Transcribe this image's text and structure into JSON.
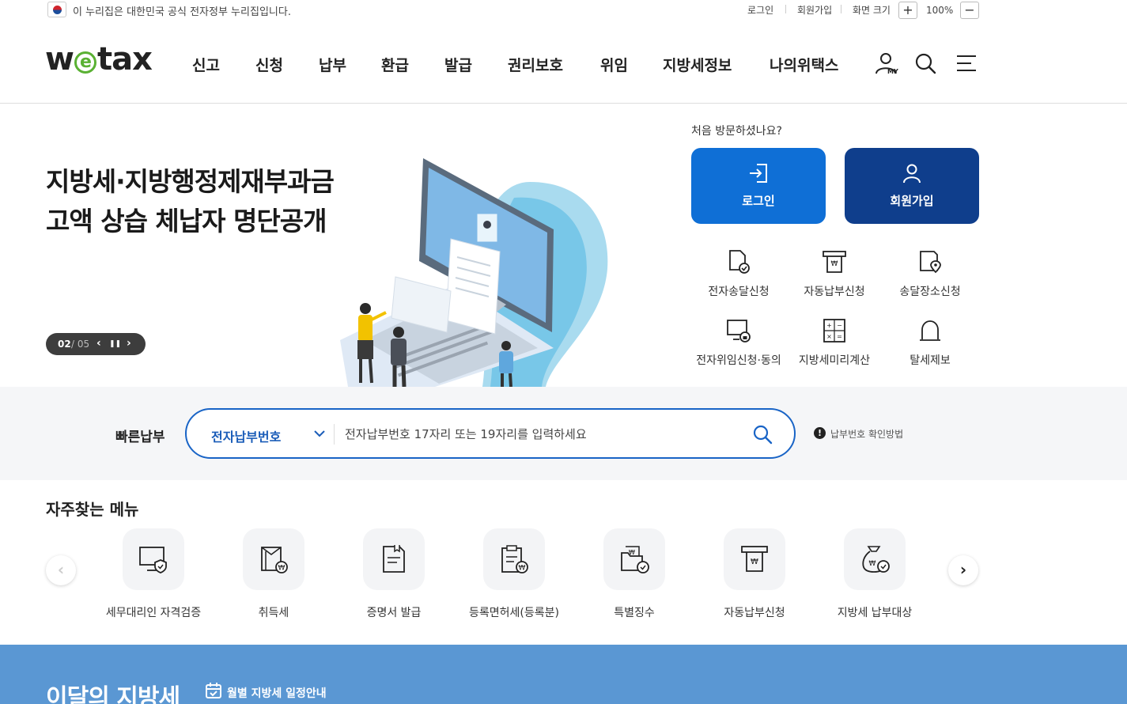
{
  "gov_banner": {
    "text": "이 누리집은 대한민국 공식 전자정부 누리집입니다.",
    "login": "로그인",
    "signup": "회원가입",
    "font_size_label": "화면 크기",
    "zoom_plus": "+",
    "zoom_value": "100%",
    "zoom_minus": "−"
  },
  "header": {
    "logo_w": "w",
    "logo_e": "e",
    "logo_tax": "tax",
    "nav": [
      "신고",
      "신청",
      "납부",
      "환급",
      "발급",
      "권리보호",
      "위임",
      "지방세정보",
      "나의위택스"
    ],
    "my_label": "MY"
  },
  "hero": {
    "title_line1": "지방세·지방행정제재부과금",
    "title_line2": "고액 상습 체납자 명단공개",
    "pager_current": "02",
    "pager_total": "/ 05",
    "pager_prev": "‹",
    "pager_pause": "❚❚",
    "pager_next": "›"
  },
  "account_panel": {
    "first_visit": "처음 방문하셨나요?",
    "login_label": "로그인",
    "signup_label": "회원가입",
    "services": [
      "전자송달신청",
      "자동납부신청",
      "송달장소신청",
      "전자위임신청·동의",
      "지방세미리계산",
      "탈세제보"
    ],
    "colors": {
      "login_bg": "#0f6fd6",
      "signup_bg": "#0f3e8c"
    }
  },
  "quick_pay": {
    "title": "빠른납부",
    "select_value": "전자납부번호",
    "placeholder": "전자납부번호 17자리 또는 19자리를 입력하세요",
    "help_icon": "!",
    "help_text": "납부번호 확인방법",
    "border_color": "#1964c6"
  },
  "frequent_menu": {
    "title": "자주찾는 메뉴",
    "prev": "‹",
    "next": "›",
    "items": [
      "세무대리인 자격검증",
      "취득세",
      "증명서 발급",
      "등록면허세(등록분)",
      "특별징수",
      "자동납부신청",
      "지방세 납부대상"
    ]
  },
  "monthly": {
    "title": "이달의 지방세",
    "link": "월별 지방세 일정안내",
    "bg_color": "#5a97d3"
  }
}
